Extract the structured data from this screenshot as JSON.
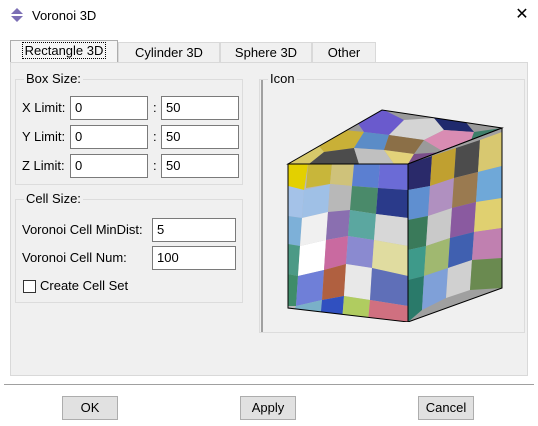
{
  "window": {
    "title": "Voronoi 3D",
    "icon": "app-icon",
    "close_label": "✕"
  },
  "tabs": [
    {
      "label": "Rectangle 3D",
      "active": true
    },
    {
      "label": "Cylinder 3D",
      "active": false
    },
    {
      "label": "Sphere 3D",
      "active": false
    },
    {
      "label": "Other",
      "active": false
    }
  ],
  "box_size": {
    "title": "Box Size:",
    "separator": ":",
    "rows": [
      {
        "label": "X Limit:",
        "min": "0",
        "max": "50"
      },
      {
        "label": "Y Limit:",
        "min": "0",
        "max": "50"
      },
      {
        "label": "Z Limit:",
        "min": "0",
        "max": "50"
      }
    ]
  },
  "cell_size": {
    "title": "Cell Size:",
    "min_dist_label": "Voronoi Cell MinDist:",
    "min_dist_value": "5",
    "num_label": "Voronoi Cell Num:",
    "num_value": "100",
    "create_set_label": "Create Cell Set",
    "create_set_checked": false
  },
  "icon_group": {
    "title": "Icon"
  },
  "buttons": {
    "ok": "OK",
    "apply": "Apply",
    "cancel": "Cancel"
  }
}
